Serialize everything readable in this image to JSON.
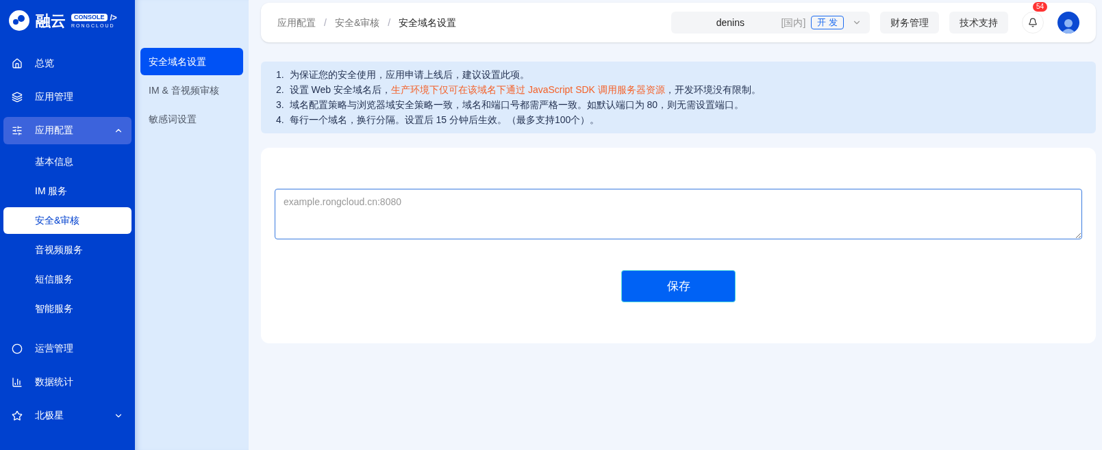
{
  "logo": {
    "name": "融云",
    "badge": "CONSOLE",
    "badge_mark": "/>",
    "subtitle": "RONGCLOUD"
  },
  "sidebar": {
    "items": [
      {
        "label": "总览",
        "selected": false
      },
      {
        "label": "应用管理",
        "selected": false
      },
      {
        "label": "应用配置",
        "selected": false,
        "expanded": true,
        "children": [
          {
            "label": "基本信息",
            "selected": false
          },
          {
            "label": "IM 服务",
            "selected": false
          },
          {
            "label": "安全&审核",
            "selected": true
          },
          {
            "label": "音视频服务",
            "selected": false
          },
          {
            "label": "短信服务",
            "selected": false
          },
          {
            "label": "智能服务",
            "selected": false
          }
        ]
      },
      {
        "label": "运营管理",
        "selected": false
      },
      {
        "label": "数据统计",
        "selected": false
      },
      {
        "label": "北极星",
        "selected": false,
        "expanded": false
      }
    ]
  },
  "subnav": {
    "items": [
      {
        "label": "安全域名设置",
        "selected": true
      },
      {
        "label": "IM & 音视频审核",
        "selected": false
      },
      {
        "label": "敏感词设置",
        "selected": false
      }
    ]
  },
  "breadcrumb": {
    "separator": "/",
    "items": [
      "应用配置",
      "安全&审核",
      "安全域名设置"
    ]
  },
  "header": {
    "app": {
      "name": "denins",
      "region": "[国内]",
      "env": "开 发"
    },
    "buttons": [
      "财务管理",
      "技术支持"
    ],
    "notifications": "54"
  },
  "notes": [
    {
      "number": "1.",
      "before": "为保证您的安全使用，应用申请上线后，建议设置此项。"
    },
    {
      "number": "2.",
      "before": "设置 Web 安全域名后，",
      "highlight": "生产环境下仅可在该域名下通过 JavaScript SDK 调用服务器资源",
      "after": "，开发环境没有限制。"
    },
    {
      "number": "3.",
      "before": "域名配置策略与浏览器域安全策略一致，域名和端口号都需严格一致。如默认端口为 80，则无需设置端口。"
    },
    {
      "number": "4.",
      "before": "每行一个域名，换行分隔。设置后 15 分钟后生效。（最多支持100个）。"
    }
  ],
  "form": {
    "domains": {
      "placeholder": "example.rongcloud.cn:8080"
    },
    "save": "保存"
  }
}
